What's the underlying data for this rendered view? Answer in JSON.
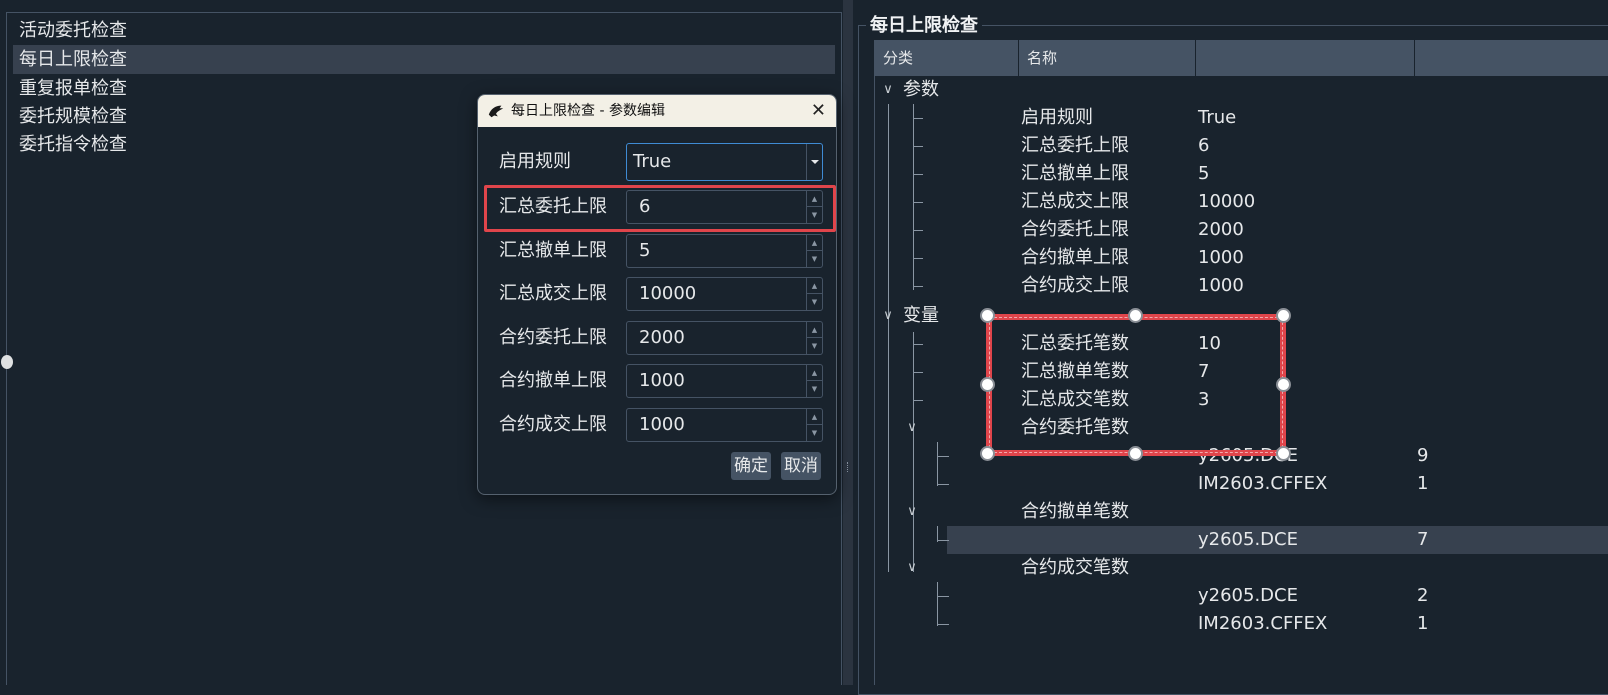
{
  "rule_list": {
    "items": [
      "活动委托检查",
      "每日上限检查",
      "重复报单检查",
      "委托规模检查",
      "委托指令检查"
    ],
    "selected_index": 1
  },
  "group": {
    "title": "每日上限检查"
  },
  "tree": {
    "headers": [
      "分类",
      "名称",
      "",
      ""
    ],
    "params_label": "参数",
    "params": [
      {
        "name": "启用规则",
        "value": "True"
      },
      {
        "name": "汇总委托上限",
        "value": "6"
      },
      {
        "name": "汇总撤单上限",
        "value": "5"
      },
      {
        "name": "汇总成交上限",
        "value": "10000"
      },
      {
        "name": "合约委托上限",
        "value": "2000"
      },
      {
        "name": "合约撤单上限",
        "value": "1000"
      },
      {
        "name": "合约成交上限",
        "value": "1000"
      }
    ],
    "vars_label": "变量",
    "vars": [
      {
        "name": "汇总委托笔数",
        "value": "10"
      },
      {
        "name": "汇总撤单笔数",
        "value": "7"
      },
      {
        "name": "汇总成交笔数",
        "value": "3"
      }
    ],
    "groups": [
      {
        "name": "合约委托笔数",
        "children": [
          {
            "symbol": "y2605.DCE",
            "count": "9"
          },
          {
            "symbol": "IM2603.CFFEX",
            "count": "1"
          }
        ]
      },
      {
        "name": "合约撤单笔数",
        "children": [
          {
            "symbol": "y2605.DCE",
            "count": "7"
          }
        ]
      },
      {
        "name": "合约成交笔数",
        "children": [
          {
            "symbol": "y2605.DCE",
            "count": "2"
          },
          {
            "symbol": "IM2603.CFFEX",
            "count": "1"
          }
        ]
      }
    ]
  },
  "dialog": {
    "title": "每日上限检查 - 参数编辑",
    "close_glyph": "✕",
    "combo": {
      "label": "启用规则",
      "value": "True"
    },
    "fields": [
      {
        "label": "汇总委托上限",
        "value": "6"
      },
      {
        "label": "汇总撤单上限",
        "value": "5"
      },
      {
        "label": "汇总成交上限",
        "value": "10000"
      },
      {
        "label": "合约委托上限",
        "value": "2000"
      },
      {
        "label": "合约撤单上限",
        "value": "1000"
      },
      {
        "label": "合约成交上限",
        "value": "1000"
      }
    ],
    "ok_label": "确定",
    "cancel_label": "取消"
  },
  "colors": {
    "background": "#19232d",
    "border": "#455364",
    "selection": "#37414f",
    "highlight": "#e0454b",
    "focus": "#3f8bd4"
  }
}
